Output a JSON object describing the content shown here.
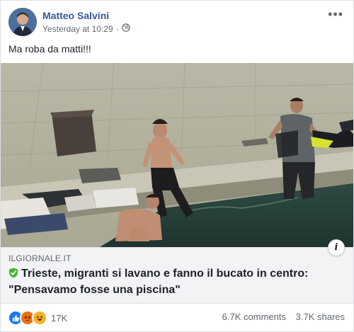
{
  "post": {
    "author": "Matteo Salvini",
    "timestamp": "Yesterday at 10:29",
    "privacy_icon": "globe-icon",
    "more_label": "•••",
    "text": "Ma roba da matti!!!"
  },
  "link": {
    "domain": "ILGIORNALE.IT",
    "headline": "Trieste, migranti si lavano e fanno il bucato in centro: \"Pensavamo fosse una piscina\"",
    "info_label": "i"
  },
  "footer": {
    "reaction_icons": [
      "like-icon",
      "angry-icon",
      "haha-icon"
    ],
    "reaction_count": "17K",
    "comments": "6.7K comments",
    "shares": "3.7K shares"
  },
  "colors": {
    "author": "#385898",
    "like": "#1877f2",
    "angry": "#e9710f",
    "haha": "#f7b125",
    "verified": "#42b72a"
  }
}
